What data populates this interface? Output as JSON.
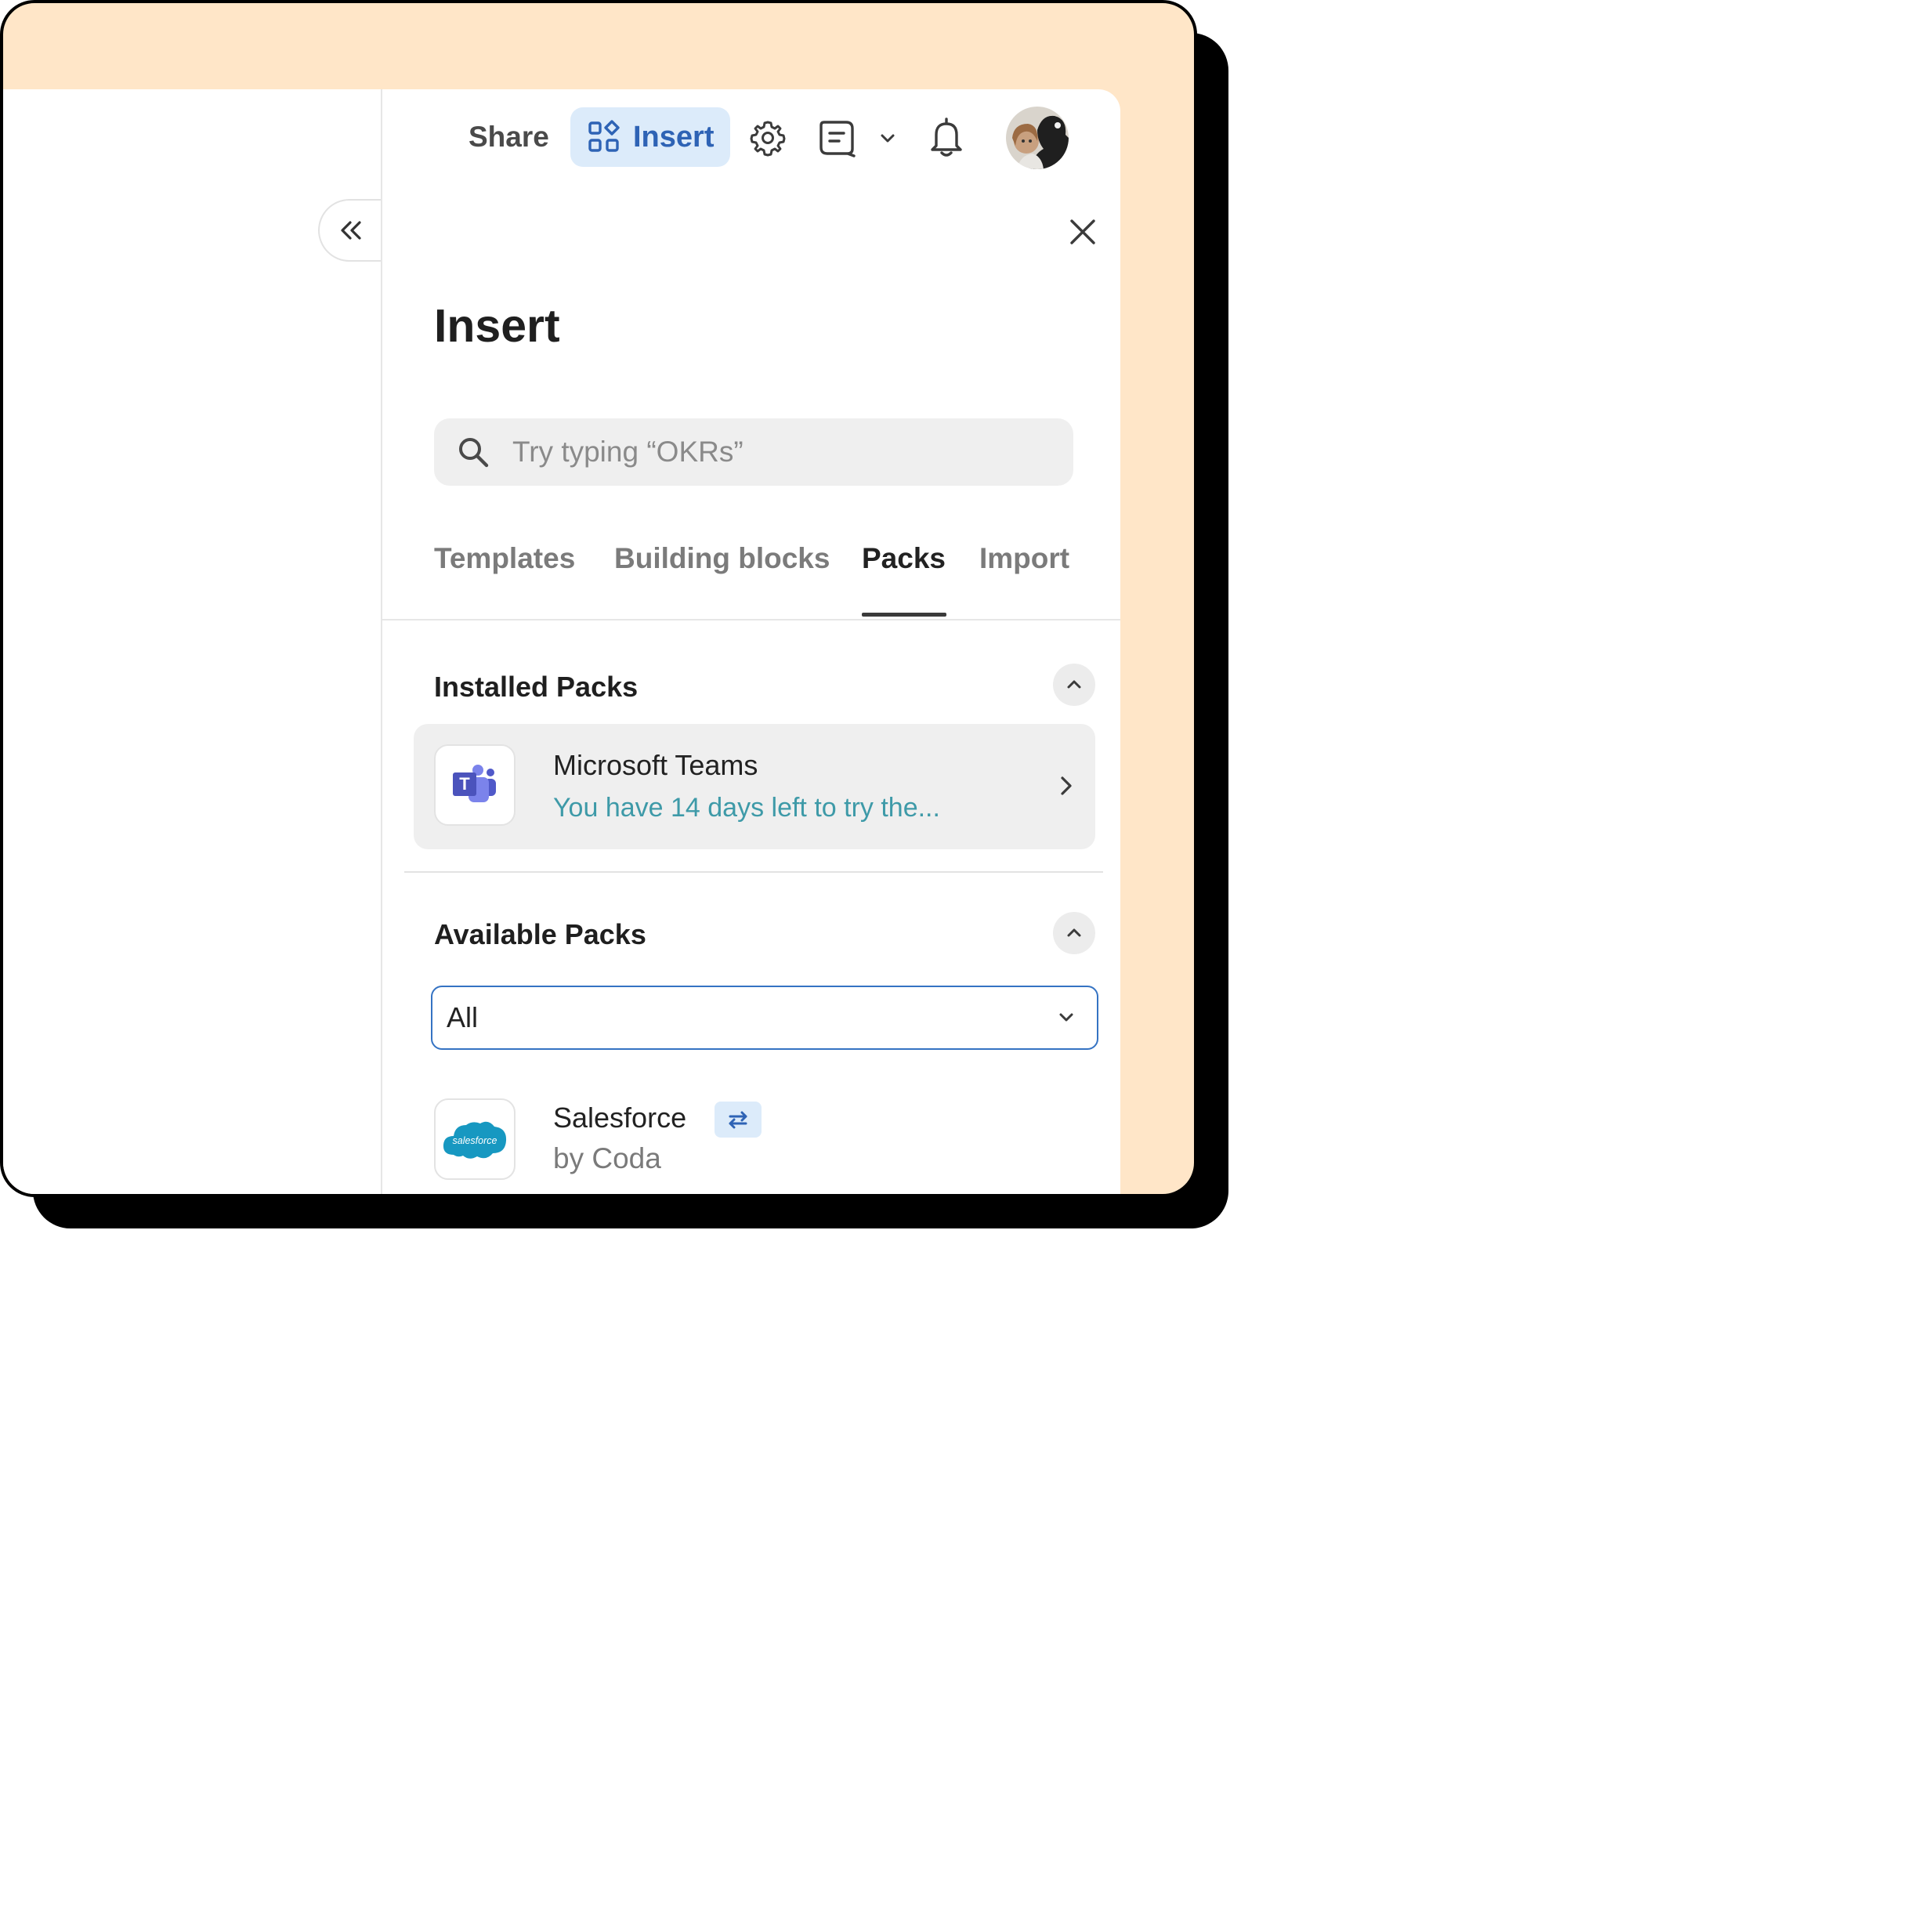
{
  "header": {
    "share_label": "Share",
    "insert_label": "Insert"
  },
  "panel": {
    "title": "Insert",
    "search_placeholder": "Try typing “OKRs”",
    "tabs": [
      {
        "label": "Templates"
      },
      {
        "label": "Building blocks"
      },
      {
        "label": "Packs",
        "active": true
      },
      {
        "label": "Import"
      }
    ]
  },
  "installed": {
    "title": "Installed Packs",
    "items": [
      {
        "name": "Microsoft Teams",
        "subtitle": "You have 14 days left to try the...",
        "logo_text": "T"
      }
    ]
  },
  "available": {
    "title": "Available Packs",
    "filter_value": "All",
    "items": [
      {
        "name": "Salesforce",
        "author": "by Coda",
        "logo_text": "salesforce",
        "badge_icon": "sync-arrows-icon"
      }
    ]
  },
  "colors": {
    "accent": "#2E63B5",
    "accent_bg": "#DCEBFA",
    "peach_bg": "#FFE6C8",
    "teal_text": "#3E9AA8"
  }
}
